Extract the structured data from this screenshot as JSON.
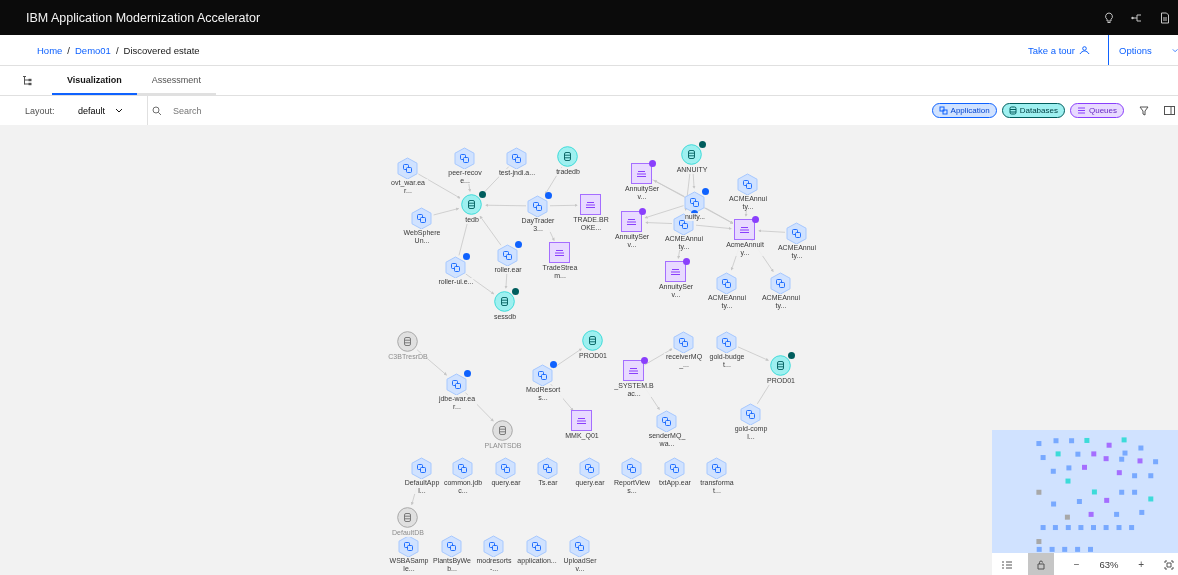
{
  "header": {
    "title": "IBM Application Modernization Accelerator"
  },
  "breadcrumb": [
    {
      "label": "Home",
      "link": true
    },
    {
      "label": "Demo01",
      "link": true
    },
    {
      "label": "Discovered estate",
      "link": false
    }
  ],
  "breadcrumb_separator": "/",
  "tour": {
    "label": "Take a tour"
  },
  "options": {
    "label": "Options"
  },
  "tabs": [
    {
      "label": "Visualization",
      "selected": true
    },
    {
      "label": "Assessment",
      "selected": false
    }
  ],
  "toolbar": {
    "layout_label": "Layout:",
    "layout_value": "default",
    "search_placeholder": "Search"
  },
  "filters": [
    {
      "label": "Application",
      "kind": "app"
    },
    {
      "label": "Databases",
      "kind": "db"
    },
    {
      "label": "Queues",
      "kind": "queue"
    }
  ],
  "nodes": [
    {
      "label": "ovt_war.ear...",
      "kind": "app",
      "badge": false
    },
    {
      "label": "peer-recove...",
      "kind": "app",
      "badge": false
    },
    {
      "label": "test-jndi.a...",
      "kind": "app",
      "badge": false
    },
    {
      "label": "tradedb",
      "kind": "db",
      "badge": false,
      "active": true
    },
    {
      "label": "tedb",
      "kind": "db",
      "badge": true,
      "active": true
    },
    {
      "label": "WebSphereUn...",
      "kind": "app",
      "badge": false
    },
    {
      "label": "DayTrader3...",
      "kind": "app",
      "badge": true
    },
    {
      "label": "TRADE.BROKE...",
      "kind": "queue",
      "badge": false
    },
    {
      "label": "roller.ear",
      "kind": "app",
      "badge": true
    },
    {
      "label": "roller-ui.e...",
      "kind": "app",
      "badge": true
    },
    {
      "label": "TradeStream...",
      "kind": "queue",
      "badge": false
    },
    {
      "label": "sessdb",
      "kind": "db",
      "badge": true,
      "active": true
    },
    {
      "label": "AnnuityServ...",
      "kind": "queue",
      "badge": true
    },
    {
      "label": "ANNUITY",
      "kind": "db",
      "badge": true,
      "active": true
    },
    {
      "label": "nuity...",
      "kind": "app",
      "badge": true
    },
    {
      "label": "AnnuityServ...",
      "kind": "queue",
      "badge": true
    },
    {
      "label": "ACMEAnnuity...",
      "kind": "app",
      "badge": true
    },
    {
      "label": "ACMEAnnuity...",
      "kind": "app",
      "badge": false
    },
    {
      "label": "AcmeAnnuity...",
      "kind": "queue",
      "badge": true
    },
    {
      "label": "ACMEAnnuity...",
      "kind": "app",
      "badge": false
    },
    {
      "label": "AnnuityServ...",
      "kind": "queue",
      "badge": true
    },
    {
      "label": "ACMEAnnuity...",
      "kind": "app",
      "badge": false
    },
    {
      "label": "ACMEAnnuity...",
      "kind": "app",
      "badge": false
    },
    {
      "label": "C3BTresrDB",
      "kind": "db",
      "badge": false,
      "active": false
    },
    {
      "label": "jdbe-war.ear...",
      "kind": "app",
      "badge": true
    },
    {
      "label": "PLANTSDB",
      "kind": "db",
      "badge": false,
      "active": false
    },
    {
      "label": "ModResorts...",
      "kind": "app",
      "badge": true
    },
    {
      "label": "PROD01",
      "kind": "db",
      "badge": false,
      "active": true
    },
    {
      "label": "MMK_Q01",
      "kind": "queue",
      "badge": false
    },
    {
      "label": "_SYSTEM.Bac...",
      "kind": "queue",
      "badge": true
    },
    {
      "label": "receiverMQ_...",
      "kind": "app",
      "badge": false
    },
    {
      "label": "senderMQ_wa...",
      "kind": "app",
      "badge": false
    },
    {
      "label": "gold-budget...",
      "kind": "app",
      "badge": false
    },
    {
      "label": "PROD01",
      "kind": "db",
      "badge": true,
      "active": true
    },
    {
      "label": "gold-compl...",
      "kind": "app",
      "badge": false
    },
    {
      "label": "DefaultAppl...",
      "kind": "app",
      "badge": false
    },
    {
      "label": "common.jdbc...",
      "kind": "app",
      "badge": false
    },
    {
      "label": "query.ear",
      "kind": "app",
      "badge": false
    },
    {
      "label": "Ts.ear",
      "kind": "app",
      "badge": false
    },
    {
      "label": "query.ear",
      "kind": "app",
      "badge": false
    },
    {
      "label": "ReportViews...",
      "kind": "app",
      "badge": false
    },
    {
      "label": "txtApp.ear",
      "kind": "app",
      "badge": false
    },
    {
      "label": "transformat...",
      "kind": "app",
      "badge": false
    },
    {
      "label": "DefaultDB",
      "kind": "db",
      "badge": false,
      "active": false
    },
    {
      "label": "WSBASample...",
      "kind": "app",
      "badge": false
    },
    {
      "label": "PlantsByWeb...",
      "kind": "app",
      "badge": false
    },
    {
      "label": "modresorts-...",
      "kind": "app",
      "badge": false
    },
    {
      "label": "application...",
      "kind": "app",
      "badge": false
    },
    {
      "label": "UploadServ...",
      "kind": "app",
      "badge": false
    }
  ],
  "zoom": {
    "minus": "−",
    "value": "63%",
    "plus": "+"
  }
}
